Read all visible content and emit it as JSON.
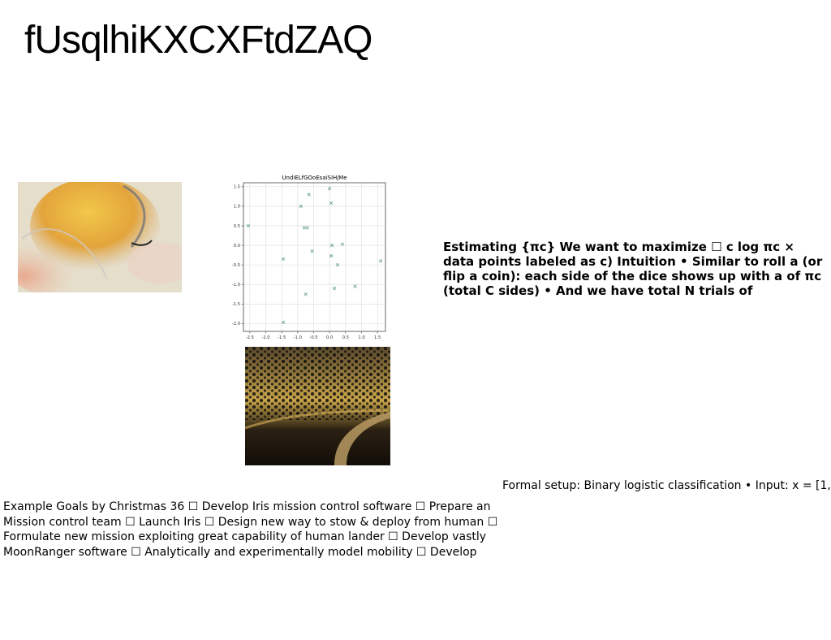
{
  "slide": {
    "title": "fUsqlhiKXCXFtdZAQ",
    "estimating_text": "Estimating {πc} We want to maximize ☐ c log πc × data points labeled as c) Intuition • Similar to roll a (or flip a coin): each side of the dice shows up with a of πc (total C sides) • And we have total N trials of",
    "formal_setup_text": "Formal setup: Binary logistic classification • Input: x = [1,",
    "goals_text": "Example Goals by Christmas 36 ☐ Develop Iris mission control software ☐ Prepare an Mission control team ☐ Launch Iris ☐ Design new way to stow & deploy from human ☐ Formulate new mission exploiting great capability of human lander ☐ Develop vastly MoonRanger software ☐ Analytically and experimentally model mobility ☐ Develop"
  },
  "chart_data": {
    "type": "scatter",
    "title": "UndiELfGOoEsaiSiHjMe",
    "xlabel": "",
    "ylabel": "",
    "xlim": [
      -2.7,
      1.75
    ],
    "ylim": [
      -2.2,
      1.6
    ],
    "xticks": [
      "-2.5",
      "-2.0",
      "-1.5",
      "-1.0",
      "-0.5",
      "0.0",
      "0.5",
      "1.0",
      "1.5"
    ],
    "yticks": [
      "1.5",
      "1.0",
      "0.5",
      "0.0",
      "-0.5",
      "-1.0",
      "-1.5",
      "-2.0"
    ],
    "grid": true,
    "marker": "x",
    "color": "#6aa58a",
    "points": [
      {
        "x": -2.55,
        "y": 0.5
      },
      {
        "x": -1.45,
        "y": -0.35
      },
      {
        "x": -1.45,
        "y": -1.97
      },
      {
        "x": -0.9,
        "y": 1.0
      },
      {
        "x": -0.8,
        "y": 0.45
      },
      {
        "x": -0.7,
        "y": 0.45
      },
      {
        "x": -0.65,
        "y": 1.3
      },
      {
        "x": -0.55,
        "y": -0.15
      },
      {
        "x": -0.75,
        "y": -1.25
      },
      {
        "x": 0.0,
        "y": 1.45
      },
      {
        "x": 0.05,
        "y": 1.08
      },
      {
        "x": 0.07,
        "y": 0.0
      },
      {
        "x": 0.05,
        "y": -0.27
      },
      {
        "x": 0.25,
        "y": -0.5
      },
      {
        "x": 0.4,
        "y": 0.03
      },
      {
        "x": 0.15,
        "y": -1.1
      },
      {
        "x": 0.8,
        "y": -1.05
      },
      {
        "x": 1.6,
        "y": -0.4
      }
    ]
  }
}
